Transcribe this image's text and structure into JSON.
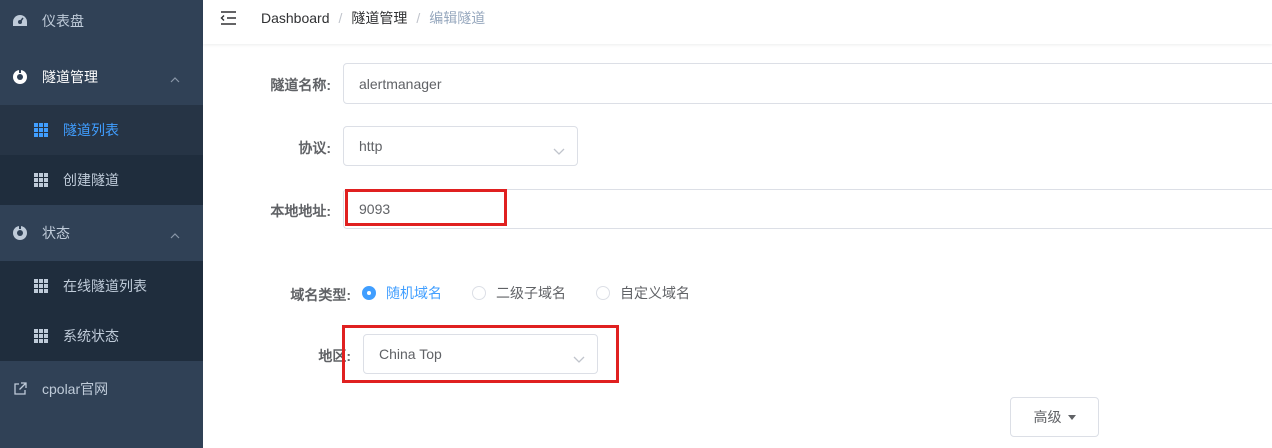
{
  "sidebar": {
    "items": [
      {
        "label": "仪表盘",
        "icon": "dashboard-icon"
      },
      {
        "label": "隧道管理",
        "icon": "tunnel-icon"
      },
      {
        "label": "隧道列表",
        "icon": "grid-icon"
      },
      {
        "label": "创建隧道",
        "icon": "grid-icon"
      },
      {
        "label": "状态",
        "icon": "status-icon"
      },
      {
        "label": "在线隧道列表",
        "icon": "grid-icon"
      },
      {
        "label": "系统状态",
        "icon": "grid-icon"
      },
      {
        "label": "cpolar官网",
        "icon": "external-link-icon"
      }
    ]
  },
  "breadcrumb": [
    "Dashboard",
    "隧道管理",
    "编辑隧道"
  ],
  "form": {
    "name_label": "隧道名称:",
    "name_value": "alertmanager",
    "protocol_label": "协议:",
    "protocol_value": "http",
    "local_label": "本地地址:",
    "local_value": "9093",
    "domain_type_label": "域名类型:",
    "domain_options": [
      "随机域名",
      "二级子域名",
      "自定义域名"
    ],
    "domain_selected": "随机域名",
    "region_label": "地区:",
    "region_value": "China Top",
    "advanced_label": "高级"
  },
  "colors": {
    "sidebar_bg": "#304156",
    "submenu_bg": "#1f2d3d",
    "active": "#409eff",
    "highlight": "#e02020"
  }
}
